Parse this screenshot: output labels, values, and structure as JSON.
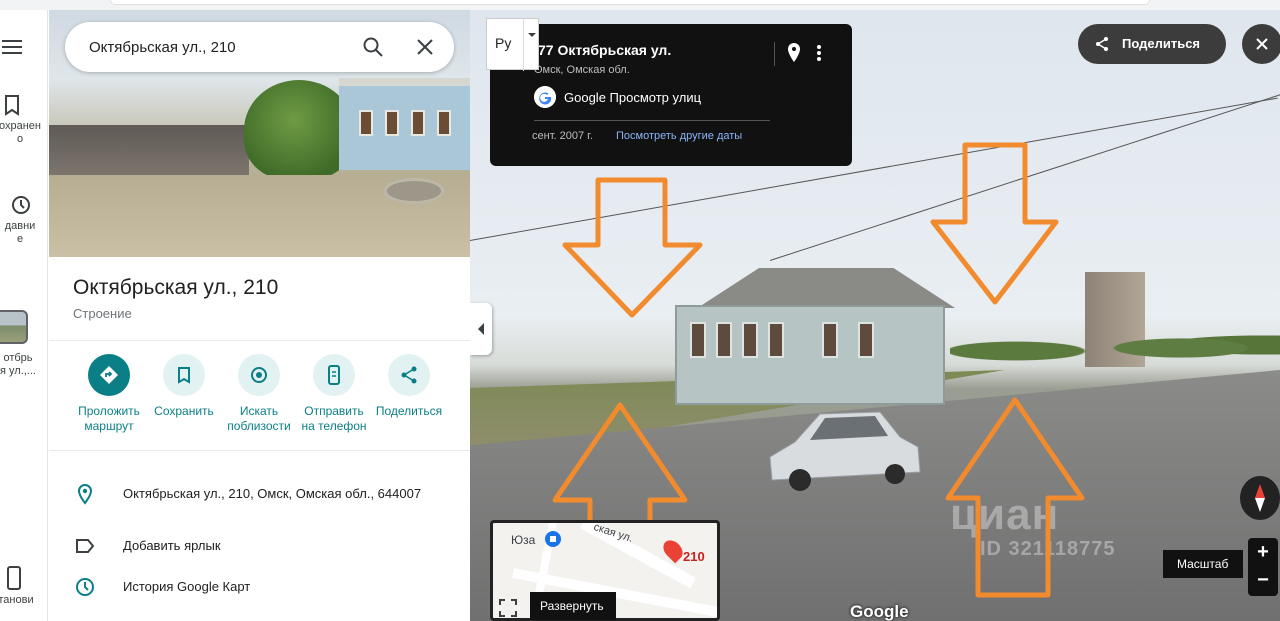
{
  "search": {
    "value": "Октябрьская ул., 210"
  },
  "rail": {
    "items": [
      {
        "label": "охранен\nо"
      },
      {
        "label": "давни\nе"
      },
      {
        "label": "отбрь\nя ул.,..."
      },
      {
        "label": "танови"
      }
    ]
  },
  "place": {
    "title": "Октябрьская ул., 210",
    "subtitle": "Строение"
  },
  "actions": [
    {
      "label": "Проложить\nмаршрут",
      "icon": "directions-icon"
    },
    {
      "label": "Сохранить",
      "icon": "bookmark-icon"
    },
    {
      "label": "Искать\nпоблизости",
      "icon": "nearby-icon"
    },
    {
      "label": "Отправить\nна телефон",
      "icon": "phone-icon"
    },
    {
      "label": "Поделиться",
      "icon": "share-icon"
    }
  ],
  "details": {
    "address": "Октябрьская ул., 210, Омск, Омская обл., 644007",
    "add_label": "Добавить ярлык",
    "history": "История Google Карт"
  },
  "streetview": {
    "card": {
      "address": "77 Октябрьская ул.",
      "region": "Омск, Омская обл.",
      "service": "Google Просмотр улиц",
      "date": "сент. 2007 г.",
      "other_dates": "Посмотреть другие даты"
    },
    "lang": "Ру",
    "share_label": "Поделиться",
    "minimap": {
      "poi": "Юза",
      "street": "ская ул.",
      "number": "210",
      "expand": "Развернуть"
    },
    "scale": "Масштаб",
    "zoom_in": "+",
    "zoom_out": "−",
    "google": "Google",
    "watermark": "циан",
    "watermark_id": "ID 321118775"
  },
  "colors": {
    "accent": "#0b7f86",
    "arrow": "#f28a2e",
    "dark": "#111111"
  }
}
